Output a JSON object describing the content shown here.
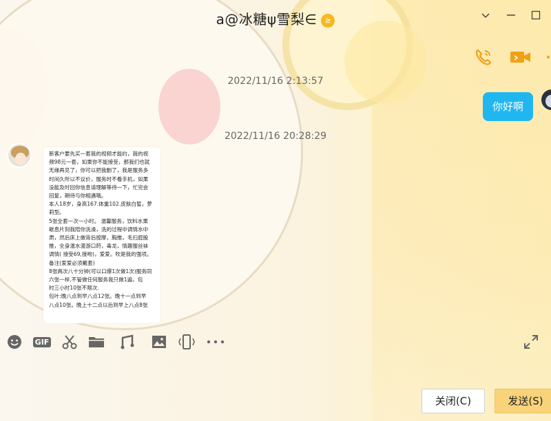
{
  "window": {
    "title": "a@冰糖ψ雪梨∈",
    "title_badge": "≥",
    "minimize": "⌵",
    "restore": "—",
    "maximize": "☐"
  },
  "header_icons": [
    "phone-call-icon",
    "video-call-icon",
    "more-icon"
  ],
  "messages": {
    "timestamp1": "2022/11/16 2:13:57",
    "my_message": "你好啊",
    "timestamp2": "2022/11/16 20:28:29",
    "other_message_lines": [
      "新客户要先买一套我的视频才能约，我的视",
      "频98元一套，如果你不能接受，那我们也就",
      "无缘再见了，你可以把我删了，我是服务多",
      "时间久所以不议价，服务时不看手机，如果",
      "没能及时回你信息请理解等待一下，忙完会",
      "回复，期待与你相遇哦。",
      "本人18岁，身高167.体重102.皮肤白皙，萝",
      "莉型。",
      "5张全套一次一小时。 温馨服务，饮料水果",
      "歇息片刻我陪你洗澡，洗的过程中调情水中",
      "肃，然后床上做背后按摩，胸推，毛扫屁股",
      "推，全身温水漫游口莳，毒龙，情趣服丝袜",
      "调情( 接受69,接吻)，爱爱。吹是我的强项。",
      "备注(爱爱必须戴套)",
      "8张两次八十分钟(可以口爆1次做1次)服务同",
      "六张一样,不管做任何服务我只做1遍，包",
      "时三小时10张不限次.",
      "包叶:晚八点到早八点12张。晚十一点到早",
      "八点10张。晚上十二点以后到早上八点8张"
    ]
  },
  "toolbar": {
    "gif_label": "GIF",
    "icons": [
      "emoji-icon",
      "gif-icon",
      "scissors-icon",
      "folder-icon",
      "music-icon",
      "image-icon",
      "phone-shake-icon",
      "more-icon"
    ]
  },
  "buttons": {
    "close": "关闭(C)",
    "send": "发送(S)"
  },
  "colors": {
    "accent_blue": "#20b7f0",
    "call_icon_orange": "#f0a116",
    "send_button": "#f8d37a"
  }
}
